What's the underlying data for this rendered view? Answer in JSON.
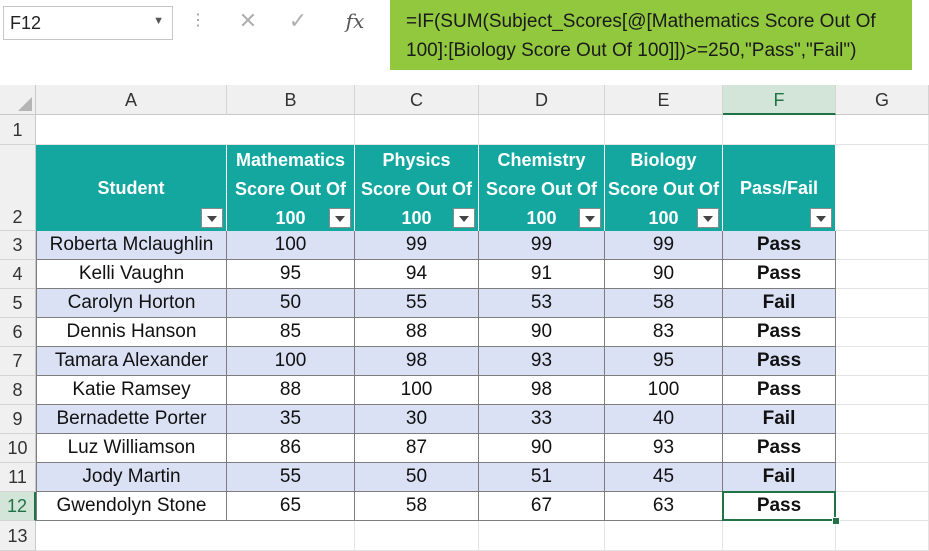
{
  "name_box": {
    "value": "F12"
  },
  "formula_bar": {
    "cancel_glyph": "✕",
    "enter_glyph": "✓",
    "fx_label": "fx",
    "formula": "=IF(SUM(Subject_Scores[@[Mathematics Score Out Of\n100]:[Biology Score Out Of 100]])>=250,\"Pass\",\"Fail\")",
    "highlight_color": "#92c83e"
  },
  "columns": [
    "A",
    "B",
    "C",
    "D",
    "E",
    "F",
    "G"
  ],
  "selected_column": "F",
  "rows": [
    "1",
    "2",
    "3",
    "4",
    "5",
    "6",
    "7",
    "8",
    "9",
    "10",
    "11",
    "12",
    "13"
  ],
  "selected_row": "12",
  "table": {
    "header_color": "#13a7a0",
    "band_color": "#dbe1f5",
    "headers": [
      "Student",
      "Mathematics Score Out Of 100",
      "Physics Score Out Of 100",
      "Chemistry Score Out Of 100",
      "Biology Score Out Of 100",
      "Pass/Fail"
    ],
    "rows": [
      [
        "Roberta Mclaughlin",
        "100",
        "99",
        "99",
        "99",
        "Pass"
      ],
      [
        "Kelli Vaughn",
        "95",
        "94",
        "91",
        "90",
        "Pass"
      ],
      [
        "Carolyn Horton",
        "50",
        "55",
        "53",
        "58",
        "Fail"
      ],
      [
        "Dennis Hanson",
        "85",
        "88",
        "90",
        "83",
        "Pass"
      ],
      [
        "Tamara Alexander",
        "100",
        "98",
        "93",
        "95",
        "Pass"
      ],
      [
        "Katie Ramsey",
        "88",
        "100",
        "98",
        "100",
        "Pass"
      ],
      [
        "Bernadette Porter",
        "35",
        "30",
        "33",
        "40",
        "Fail"
      ],
      [
        "Luz Williamson",
        "86",
        "87",
        "90",
        "93",
        "Pass"
      ],
      [
        "Jody Martin",
        "55",
        "50",
        "51",
        "45",
        "Fail"
      ],
      [
        "Gwendolyn Stone",
        "65",
        "58",
        "67",
        "63",
        "Pass"
      ]
    ]
  }
}
